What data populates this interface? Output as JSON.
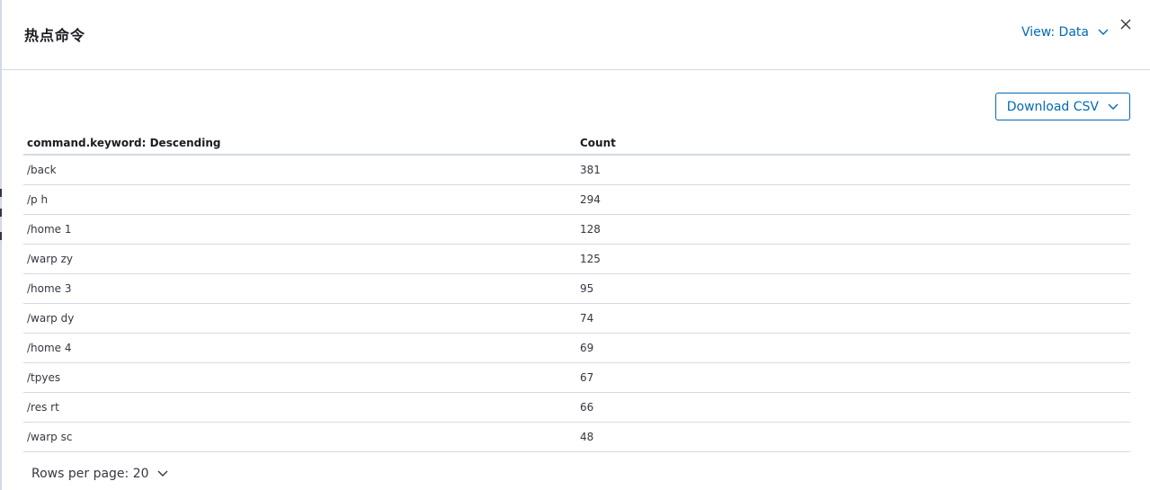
{
  "flyout": {
    "title": "热点命令",
    "view_label": "View: Data",
    "view_icon": "chevron-down-icon",
    "close_icon": "close-icon"
  },
  "toolbar": {
    "download_label": "Download CSV",
    "download_icon": "chevron-down-icon"
  },
  "table": {
    "columns": [
      "command.keyword: Descending",
      "Count"
    ],
    "rows": [
      [
        "/back",
        "381"
      ],
      [
        "/p h",
        "294"
      ],
      [
        "/home 1",
        "128"
      ],
      [
        "/warp zy",
        "125"
      ],
      [
        "/home 3",
        "95"
      ],
      [
        "/warp dy",
        "74"
      ],
      [
        "/home 4",
        "69"
      ],
      [
        "/tpyes",
        "67"
      ],
      [
        "/res rt",
        "66"
      ],
      [
        "/warp sc",
        "48"
      ]
    ]
  },
  "pagination": {
    "rows_per_page_label": "Rows per page: 20"
  },
  "colors": {
    "accent": "#006bb4",
    "border": "#d3dae6",
    "text": "#343741",
    "title": "#1a1c21"
  }
}
